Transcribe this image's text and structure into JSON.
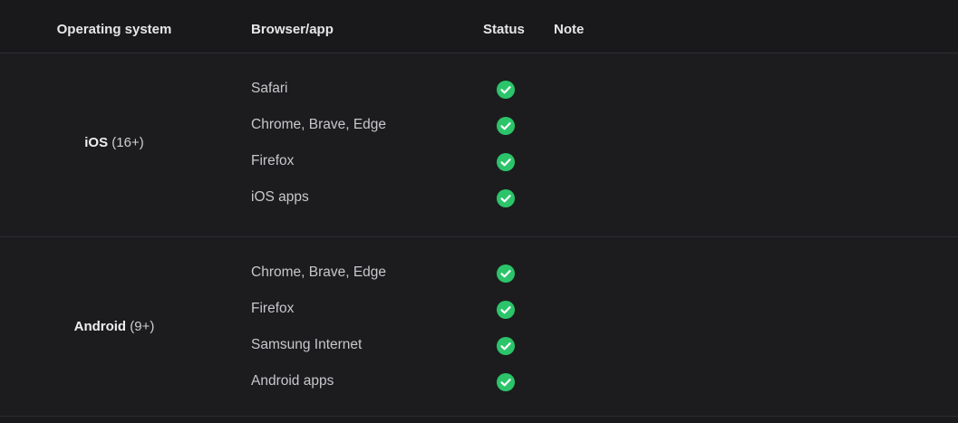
{
  "header": {
    "os": "Operating system",
    "browser": "Browser/app",
    "status": "Status",
    "note": "Note"
  },
  "groups": [
    {
      "os_name": "iOS",
      "os_version": " (16+)",
      "rows": [
        {
          "browser": "Safari",
          "status": "check-icon"
        },
        {
          "browser": "Chrome, Brave, Edge",
          "status": "check-icon"
        },
        {
          "browser": "Firefox",
          "status": "check-icon"
        },
        {
          "browser": "iOS apps",
          "status": "check-icon"
        }
      ]
    },
    {
      "os_name": "Android",
      "os_version": " (9+)",
      "rows": [
        {
          "browser": "Chrome, Brave, Edge",
          "status": "check-icon"
        },
        {
          "browser": "Firefox",
          "status": "check-icon"
        },
        {
          "browser": "Samsung Internet",
          "status": "check-icon"
        },
        {
          "browser": "Android apps",
          "status": "check-icon"
        }
      ]
    }
  ],
  "colors": {
    "background": "#1c1c1e",
    "check": "#2cc46a",
    "divider": "#2c2c34"
  }
}
